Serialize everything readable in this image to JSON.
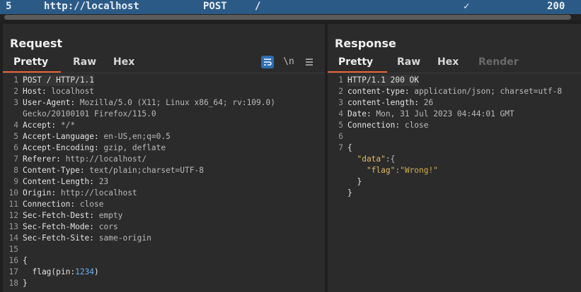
{
  "history_row": {
    "id": "5",
    "url": "http://localhost",
    "method": "POST",
    "path": "/",
    "check": "✓",
    "status": "200"
  },
  "request": {
    "title": "Request",
    "tabs": [
      "Pretty",
      "Raw",
      "Hex"
    ],
    "tools": {
      "wrap_icon": "wrap-lines-icon",
      "newline_label": "\\n",
      "menu_icon": "hamburger-menu-icon"
    },
    "lines": [
      {
        "n": "1",
        "k": "POST / HTTP/1.1",
        "v": ""
      },
      {
        "n": "2",
        "k": "Host:",
        "v": " localhost"
      },
      {
        "n": "3",
        "k": "User-Agent:",
        "v": " Mozilla/5.0 (X11; Linux x86_64; rv:109.0)"
      },
      {
        "n": "",
        "k": "",
        "v": "Gecko/20100101 Firefox/115.0"
      },
      {
        "n": "4",
        "k": "Accept:",
        "v": " */*"
      },
      {
        "n": "5",
        "k": "Accept-Language:",
        "v": " en-US,en;q=0.5"
      },
      {
        "n": "6",
        "k": "Accept-Encoding:",
        "v": " gzip, deflate"
      },
      {
        "n": "7",
        "k": "Referer:",
        "v": " http://localhost/"
      },
      {
        "n": "8",
        "k": "Content-Type:",
        "v": " text/plain;charset=UTF-8"
      },
      {
        "n": "9",
        "k": "Content-Length:",
        "v": " 23"
      },
      {
        "n": "10",
        "k": "Origin:",
        "v": " http://localhost"
      },
      {
        "n": "11",
        "k": "Connection:",
        "v": " close"
      },
      {
        "n": "12",
        "k": "Sec-Fetch-Dest:",
        "v": " empty"
      },
      {
        "n": "13",
        "k": "Sec-Fetch-Mode:",
        "v": " cors"
      },
      {
        "n": "14",
        "k": "Sec-Fetch-Site:",
        "v": " same-origin"
      },
      {
        "n": "15",
        "k": "",
        "v": ""
      },
      {
        "n": "16",
        "k": "{",
        "v": ""
      },
      {
        "n": "17",
        "k": "  flag(pin:",
        "v": "1234",
        "t": ")"
      },
      {
        "n": "18",
        "k": "}",
        "v": ""
      }
    ]
  },
  "response": {
    "title": "Response",
    "tabs": [
      "Pretty",
      "Raw",
      "Hex",
      "Render"
    ],
    "lines": [
      {
        "n": "1",
        "k": "HTTP/1.1 200 OK",
        "v": ""
      },
      {
        "n": "2",
        "k": "content-type:",
        "v": " application/json; charset=utf-8"
      },
      {
        "n": "3",
        "k": "content-length:",
        "v": " 26"
      },
      {
        "n": "4",
        "k": "Date:",
        "v": " Mon, 31 Jul 2023 04:44:01 GMT"
      },
      {
        "n": "5",
        "k": "Connection:",
        "v": " close"
      },
      {
        "n": "6",
        "k": "",
        "v": ""
      },
      {
        "n": "7",
        "k": "{",
        "v": ""
      },
      {
        "n": "",
        "k": "  \"data\"",
        "v": ":{"
      },
      {
        "n": "",
        "k": "    \"flag\"",
        "v": ":\"Wrong!\""
      },
      {
        "n": "",
        "k": "  }",
        "v": ""
      },
      {
        "n": "",
        "k": "}",
        "v": ""
      }
    ]
  },
  "colors": {
    "accent": "#e8643a",
    "selection": "#2c5a87",
    "tool_active": "#2e6fb2"
  }
}
